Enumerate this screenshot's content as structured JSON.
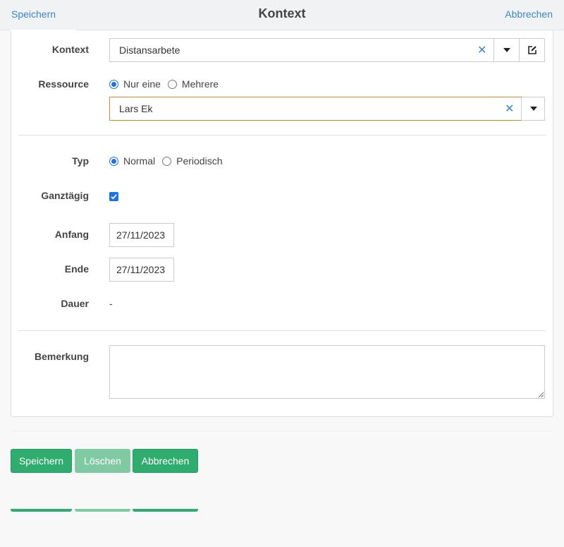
{
  "header": {
    "left_action": "Speichern",
    "title": "Kontext",
    "right_action": "Abbrechen"
  },
  "form": {
    "kontext": {
      "label": "Kontext",
      "value": "Distansarbete"
    },
    "ressource": {
      "label": "Ressource",
      "options": [
        "Nur eine",
        "Mehrere"
      ],
      "selected": "Nur eine",
      "value": "Lars Ek"
    },
    "typ": {
      "label": "Typ",
      "options": [
        "Normal",
        "Periodisch"
      ],
      "selected": "Normal"
    },
    "ganztaegig": {
      "label": "Ganztägig",
      "checked": true
    },
    "anfang": {
      "label": "Anfang",
      "value": "27/11/2023"
    },
    "ende": {
      "label": "Ende",
      "value": "27/11/2023"
    },
    "dauer": {
      "label": "Dauer",
      "value": "-"
    },
    "bemerkung": {
      "label": "Bemerkung",
      "value": ""
    }
  },
  "footer": {
    "save": "Speichern",
    "delete": "Löschen",
    "cancel": "Abbrechen"
  },
  "colors": {
    "accent": "#2fad6f",
    "accent_disabled": "#7fcaa2",
    "link": "#3a86c8",
    "focus_border": "#d08a2c",
    "radio_checked": "#1a73e8"
  },
  "icons": {
    "clear": "close-icon",
    "dropdown": "chevron-down-icon",
    "edit": "edit-icon"
  }
}
